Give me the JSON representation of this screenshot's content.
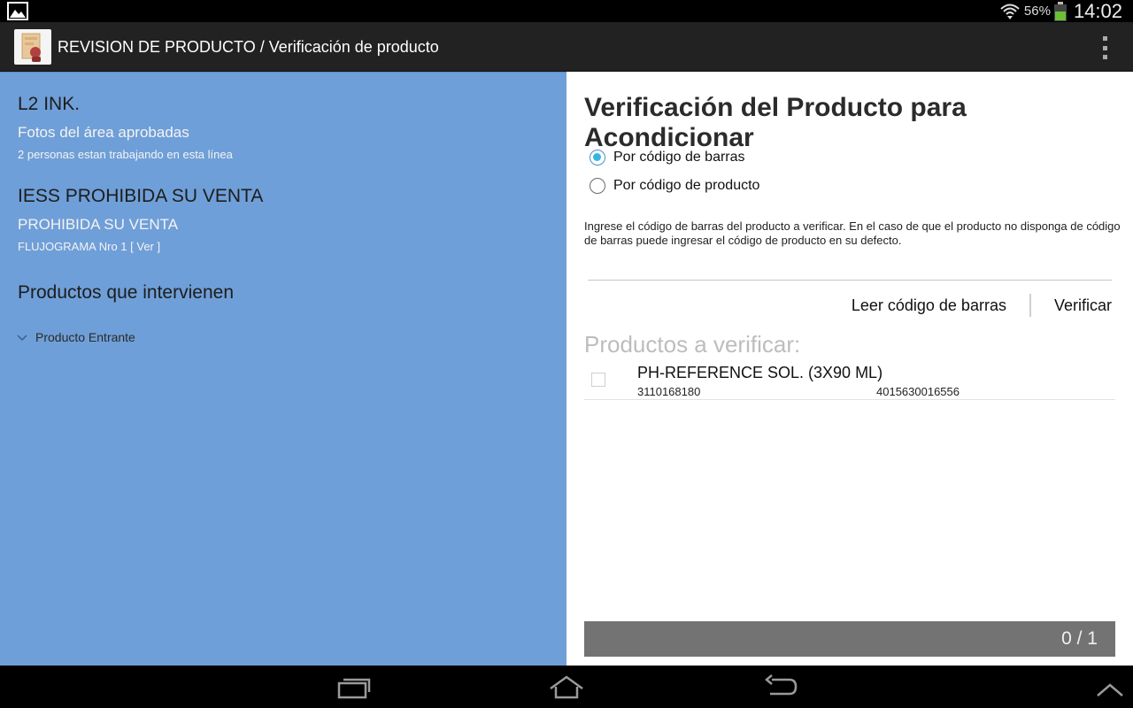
{
  "status_bar": {
    "battery_percent": "56%",
    "time": "14:02",
    "icons": [
      "gallery-icon",
      "wifi-icon",
      "battery-icon"
    ]
  },
  "action_bar": {
    "title": "REVISION DE PRODUCTO / Verificación de producto",
    "icons": [
      "app-icon",
      "overflow-menu-icon"
    ]
  },
  "left_pane": {
    "line": {
      "name": "L2 INK.",
      "status": "Fotos del área aprobadas",
      "workers": "2 personas estan trabajando en esta línea"
    },
    "product": {
      "name": "IESS PROHIBIDA SU VENTA",
      "status": "PROHIBIDA SU VENTA",
      "flowchart": "FLUJOGRAMA Nro 1 [ Ver ]"
    },
    "products_heading": "Productos que intervienen",
    "tree": [
      {
        "label": "Producto Entrante",
        "expanded": true
      }
    ]
  },
  "right_pane": {
    "title": "Verificación del Producto para Acondicionar",
    "radio_options": [
      {
        "label": "Por código de barras",
        "selected": true
      },
      {
        "label": "Por código de producto",
        "selected": false
      }
    ],
    "instructions": "Ingrese el código de barras del producto a verificar. En el caso de que el producto no disponga de código de barras puede ingresar el código de producto en su defecto.",
    "input": {
      "value": "",
      "placeholder": ""
    },
    "buttons": {
      "read_barcode": "Leer código de barras",
      "verify": "Verificar"
    },
    "products_heading": "Productos a verificar:",
    "products": [
      {
        "name": "PH-REFERENCE SOL. (3X90 ML)",
        "code": "3110168180",
        "barcode": "4015630016556",
        "checked": false
      }
    ],
    "progress": {
      "text": "0 / 1",
      "done": 0,
      "total": 1
    }
  },
  "nav_bar": {
    "icons": [
      "recent-apps-icon",
      "home-icon",
      "back-icon",
      "chevron-up-icon"
    ]
  },
  "colors": {
    "left_pane_bg": "#6f9fd8",
    "action_bar_bg": "#222222",
    "radio_accent": "#33b5e5",
    "progress_bg": "#737373",
    "battery_green": "#6bc035"
  }
}
